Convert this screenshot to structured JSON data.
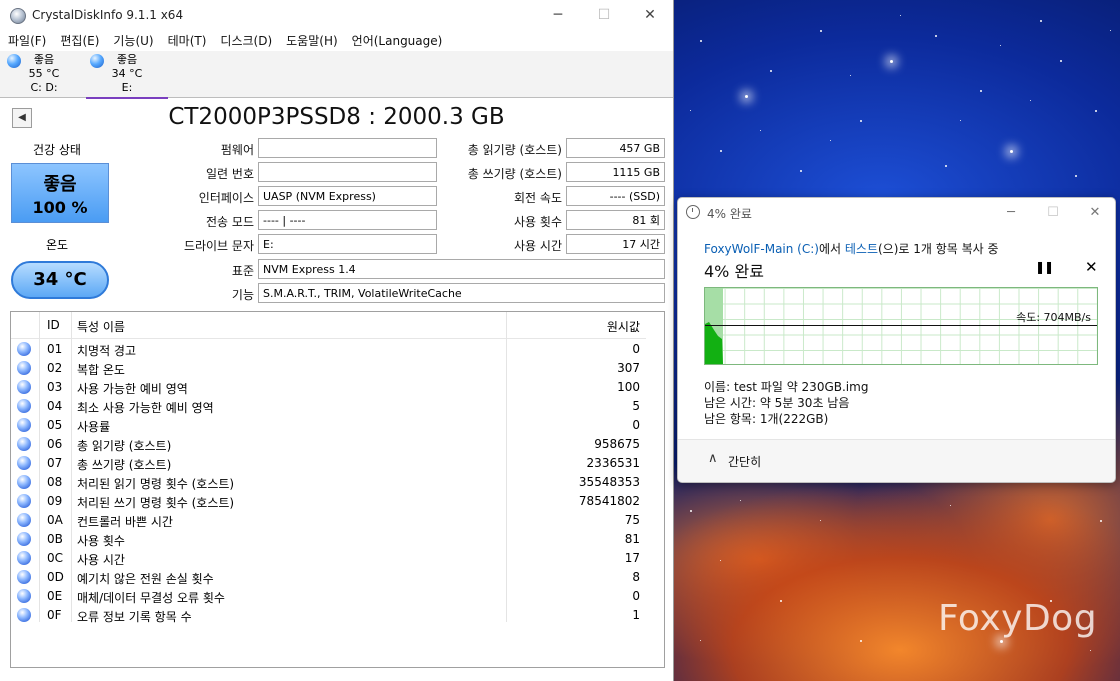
{
  "cdi": {
    "title": "CrystalDiskInfo 9.1.1 x64",
    "menu": [
      "파일(F)",
      "편집(E)",
      "기능(U)",
      "테마(T)",
      "디스크(D)",
      "도움말(H)",
      "언어(Language)"
    ],
    "disks": [
      {
        "status": "좋음",
        "temp": "55 °C",
        "letter": "C: D:"
      },
      {
        "status": "좋음",
        "temp": "34 °C",
        "letter": "E:"
      }
    ],
    "model": "CT2000P3PSSD8 : 2000.3 GB",
    "health_label": "건강 상태",
    "health_status": "좋음",
    "health_percent": "100 %",
    "temp_label": "온도",
    "temp_value": "34 °C",
    "left_labels": {
      "firmware": "펌웨어",
      "serial": "일련 번호",
      "interface": "인터페이스",
      "transfer": "전송 모드",
      "drive_letter": "드라이브 문자",
      "standard": "표준",
      "features": "기능"
    },
    "left_values": {
      "firmware": "",
      "serial": "",
      "interface": "UASP (NVM Express)",
      "transfer": "---- | ----",
      "drive_letter": "E:",
      "standard": "NVM Express 1.4",
      "features": "S.M.A.R.T., TRIM, VolatileWriteCache"
    },
    "right_labels": {
      "host_reads": "총 읽기량 (호스트)",
      "host_writes": "총 쓰기량 (호스트)",
      "rotation": "회전 속도",
      "power_count": "사용 횟수",
      "power_hours": "사용 시간"
    },
    "right_values": {
      "host_reads": "457 GB",
      "host_writes": "1115 GB",
      "rotation": "---- (SSD)",
      "power_count": "81 회",
      "power_hours": "17 시간"
    },
    "table_headers": {
      "id": "ID",
      "name": "특성 이름",
      "raw": "원시값"
    },
    "attributes": [
      {
        "id": "01",
        "name": "치명적 경고",
        "raw": "0"
      },
      {
        "id": "02",
        "name": "복합 온도",
        "raw": "307"
      },
      {
        "id": "03",
        "name": "사용 가능한 예비 영역",
        "raw": "100"
      },
      {
        "id": "04",
        "name": "최소 사용 가능한 예비 영역",
        "raw": "5"
      },
      {
        "id": "05",
        "name": "사용률",
        "raw": "0"
      },
      {
        "id": "06",
        "name": "총 읽기량 (호스트)",
        "raw": "958675"
      },
      {
        "id": "07",
        "name": "총 쓰기량 (호스트)",
        "raw": "2336531"
      },
      {
        "id": "08",
        "name": "처리된 읽기 명령 횟수 (호스트)",
        "raw": "35548353"
      },
      {
        "id": "09",
        "name": "처리된 쓰기 명령 횟수 (호스트)",
        "raw": "78541802"
      },
      {
        "id": "0A",
        "name": "컨트롤러 바쁜 시간",
        "raw": "75"
      },
      {
        "id": "0B",
        "name": "사용 횟수",
        "raw": "81"
      },
      {
        "id": "0C",
        "name": "사용 시간",
        "raw": "17"
      },
      {
        "id": "0D",
        "name": "예기치 않은 전원 손실 횟수",
        "raw": "8"
      },
      {
        "id": "0E",
        "name": "매체/데이터 무결성 오류 횟수",
        "raw": "0"
      },
      {
        "id": "0F",
        "name": "오류 정보 기록 항목 수",
        "raw": "1"
      }
    ]
  },
  "copy": {
    "title": "4% 완료",
    "source_link": "FoxyWolF-Main (C:)",
    "text_from": "에서 ",
    "dest_link": "테스트",
    "text_rest": "(으)로 1개 항목 복사 중",
    "percent_label": "4% 완료",
    "progress_fraction": 0.04,
    "speed": "속도: 704MB/s",
    "name_line": "이름: test 파일 약 230GB.img",
    "time_line": "남은 시간: 약 5분 30초 남음",
    "items_line": "남은 항목: 1개(222GB)",
    "collapse_label": "간단히"
  },
  "watermark": "FoxyDog",
  "icons": {
    "back": "arrow-left-icon",
    "health_orb": "status-orb-icon",
    "clock": "clock-icon",
    "pause": "pause-icon",
    "stop": "close-icon",
    "collapse": "chevron-up-icon"
  },
  "colors": {
    "good_blue": "#4a9cf3",
    "graph_green": "#a6dea6",
    "link_blue": "#0a5fb4"
  }
}
